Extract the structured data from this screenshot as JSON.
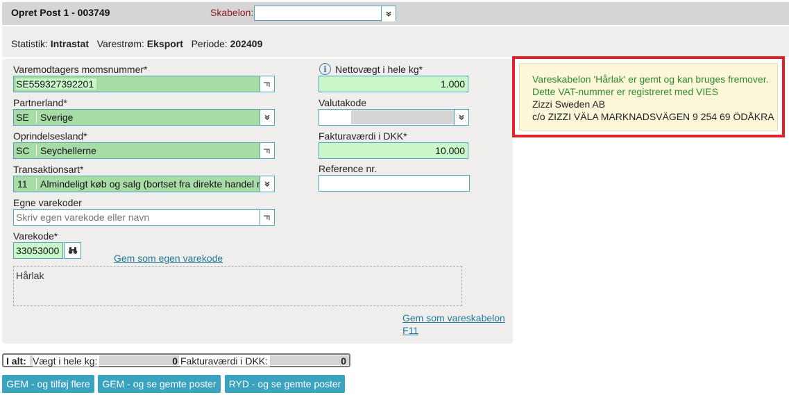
{
  "header": {
    "title": "Opret Post 1 - 003749",
    "template_label": "Skabelon:",
    "template_value": ""
  },
  "info": {
    "statistik_label": "Statistik:",
    "statistik_value": "Intrastat",
    "varestrom_label": "Varestrøm:",
    "varestrom_value": "Eksport",
    "periode_label": "Periode:",
    "periode_value": "202409"
  },
  "form": {
    "vat_label": "Varemodtagers momsnummer*",
    "vat_value": "SE559327392201",
    "partner_label": "Partnerland*",
    "partner_code": "SE",
    "partner_name": "Sverige",
    "origin_label": "Oprindelsesland*",
    "origin_code": "SC",
    "origin_name": "Seychellerne",
    "trans_label": "Transaktionsart*",
    "trans_code": "11",
    "trans_name": "Almindeligt køb og salg (bortset fra direkte handel m",
    "own_codes_label": "Egne varekoder",
    "own_codes_placeholder": "Skriv egen varekode eller navn",
    "varekode_label": "Varekode*",
    "varekode_value": "33053000",
    "save_own_code_link": "Gem som egen varekode",
    "description_text": "Hårlak",
    "save_template_link": "Gem som vareskabelon",
    "save_template_shortcut": "F11",
    "net_weight_label": "Nettovægt i hele kg*",
    "net_weight_value": "1.000",
    "currency_label": "Valutakode",
    "currency_value": "",
    "invoice_label": "Fakturaværdi i DKK*",
    "invoice_value": "10.000",
    "reference_label": "Reference nr.",
    "reference_value": ""
  },
  "notice": {
    "line1": "Vareskabelon 'Hårlak' er gemt og kan bruges fremover.",
    "line2": "Dette VAT-nummer er registreret med VIES",
    "line3": "Zizzi Sweden AB",
    "line4": "c/o ZIZZI VÄLA MARKNADSVÄGEN 9 254 69 ÖDÅKRA",
    "green_color": "#2e8b2e"
  },
  "totals": {
    "label": "I alt:",
    "weight_label": "Vægt i hele kg:",
    "weight_value": "0",
    "invoice_label": "Fakturaværdi i DKK:",
    "invoice_value": "0"
  },
  "buttons": {
    "save_add": "GEM - og tilføj flere",
    "save_view": "GEM - og se gemte poster",
    "clear_view": "RYD - og se gemte poster"
  },
  "icons": {
    "dropdown": "chevron-double-down-icon",
    "lookup": "lookup-icon",
    "search": "binoculars-icon",
    "info": "info-icon"
  }
}
